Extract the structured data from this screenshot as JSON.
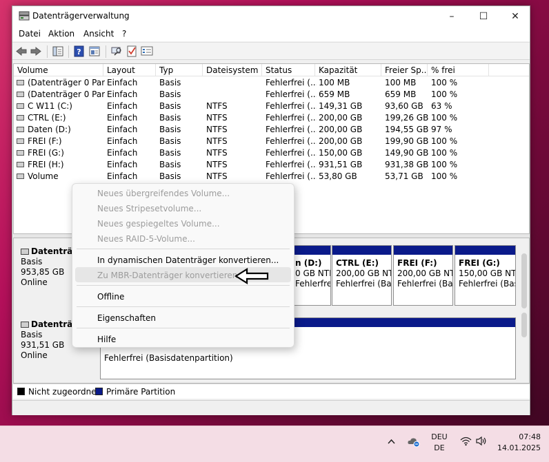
{
  "window": {
    "title": "Datenträgerverwaltung",
    "minimize_glyph": "–",
    "maximize_glyph": "☐",
    "close_glyph": "✕"
  },
  "menu": [
    "Datei",
    "Aktion",
    "Ansicht",
    "?"
  ],
  "toolbar_icons": [
    "back-arrow-icon",
    "forward-arrow-icon",
    "console-tree-icon",
    "help-icon",
    "properties-icon",
    "rescan-icon",
    "checklist-icon",
    "settings-icon"
  ],
  "volume_list": {
    "columns": [
      "Volume",
      "Layout",
      "Typ",
      "Dateisystem",
      "Status",
      "Kapazität",
      "Freier Sp...",
      "% frei"
    ],
    "rows": [
      [
        "(Datenträger 0 Par...",
        "Einfach",
        "Basis",
        "",
        "Fehlerfrei (...",
        "100 MB",
        "100 MB",
        "100 %"
      ],
      [
        "(Datenträger 0 Par...",
        "Einfach",
        "Basis",
        "",
        "Fehlerfrei (...",
        "659 MB",
        "659 MB",
        "100 %"
      ],
      [
        "C W11 (C:)",
        "Einfach",
        "Basis",
        "NTFS",
        "Fehlerfrei (...",
        "149,31 GB",
        "93,60 GB",
        "63 %"
      ],
      [
        "CTRL (E:)",
        "Einfach",
        "Basis",
        "NTFS",
        "Fehlerfrei (...",
        "200,00 GB",
        "199,26 GB",
        "100 %"
      ],
      [
        "Daten (D:)",
        "Einfach",
        "Basis",
        "NTFS",
        "Fehlerfrei (...",
        "200,00 GB",
        "194,55 GB",
        "97 %"
      ],
      [
        "FREI (F:)",
        "Einfach",
        "Basis",
        "NTFS",
        "Fehlerfrei (...",
        "200,00 GB",
        "199,90 GB",
        "100 %"
      ],
      [
        "FREI (G:)",
        "Einfach",
        "Basis",
        "NTFS",
        "Fehlerfrei (...",
        "150,00 GB",
        "149,90 GB",
        "100 %"
      ],
      [
        "FREI (H:)",
        "Einfach",
        "Basis",
        "NTFS",
        "Fehlerfrei (...",
        "931,51 GB",
        "931,38 GB",
        "100 %"
      ],
      [
        "Volume",
        "Einfach",
        "Basis",
        "NTFS",
        "Fehlerfrei (...",
        "53,80 GB",
        "53,71 GB",
        "100 %"
      ]
    ]
  },
  "disks": [
    {
      "name": "Datenträg",
      "type": "Basis",
      "size": "953,85 GB",
      "state": "Online",
      "partitions": [
        {
          "name": "n (D:)",
          "size": "0 GB NTF",
          "status": "Fehlerfrei (Bas"
        },
        {
          "name": "CTRL (E:)",
          "size": "200,00 GB NTF",
          "status": "Fehlerfrei (Bas"
        },
        {
          "name": "FREI (F:)",
          "size": "200,00 GB NTF",
          "status": "Fehlerfrei (Bas"
        },
        {
          "name": "FREI (G:)",
          "size": "150,00 GB NTF",
          "status": "Fehlerfrei (Basi"
        }
      ]
    },
    {
      "name": "Datenträg",
      "type": "Basis",
      "size": "931,51 GB",
      "state": "Online",
      "partition_status": "Fehlerfrei (Basisdatenpartition)"
    }
  ],
  "legend": {
    "unallocated": "Nicht zugeordnet",
    "primary": "Primäre Partition",
    "unallocated_color": "#000000",
    "primary_color": "#0a1a8a"
  },
  "context_menu": {
    "items": [
      {
        "label": "Neues übergreifendes Volume...",
        "enabled": false
      },
      {
        "label": "Neues Stripesetvolume...",
        "enabled": false
      },
      {
        "label": "Neues gespiegeltes Volume...",
        "enabled": false
      },
      {
        "label": "Neues RAID-5-Volume...",
        "enabled": false
      },
      {
        "label": "In dynamischen Datenträger konvertieren...",
        "enabled": true
      },
      {
        "label": "Zu MBR-Datenträger konvertieren",
        "enabled": false
      },
      {
        "label": "Offline",
        "enabled": true
      },
      {
        "label": "Eigenschaften",
        "enabled": true
      },
      {
        "label": "Hilfe",
        "enabled": true
      }
    ]
  },
  "taskbar": {
    "lang_top": "DEU",
    "lang_bottom": "DE",
    "time": "07:48",
    "date": "14.01.2025"
  }
}
